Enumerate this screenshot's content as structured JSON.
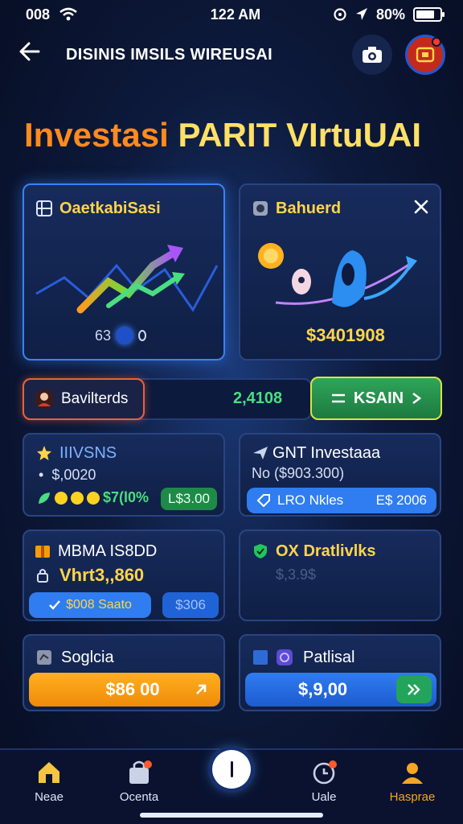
{
  "status": {
    "left": "008",
    "time": "122 AM",
    "battery": "80%",
    "battery_level": 0.8
  },
  "header": {
    "title": "DISINIS IMSILS WIREUSAI"
  },
  "hero": {
    "part1": "Investasi ",
    "part2": "PARIT VIrtuUAI"
  },
  "card_top_left": {
    "title": "OaetkabiSasi",
    "pager": "63"
  },
  "card_top_right": {
    "title": "Bahuerd",
    "amount": "$3401908"
  },
  "row_summary": {
    "label": "Bavilterds",
    "value": "2,4108",
    "action": "KSAIN"
  },
  "card_mid_left": {
    "title": "IIIVSNS",
    "sub": "$,0020",
    "rate": "$7(l0%",
    "badge": "L$3.00"
  },
  "card_mid_right": {
    "title": "GNT Investaaa",
    "sub": "No ($903.300)",
    "bar_left": "LRO Nkles",
    "bar_right": "E$ 2006"
  },
  "card_low_left": {
    "title": "MBMA IS8DD",
    "value": "Vhrt3,,860",
    "btn1": "$008 Saato",
    "btn2": "$306"
  },
  "card_low_right": {
    "title": "OX Dratlivlks",
    "sub": "$,3.9$"
  },
  "card_bot_left": {
    "title": "Soglcia",
    "btn": "$86 00"
  },
  "card_bot_right": {
    "title": "Patlisal",
    "btn": "$,9,00"
  },
  "nav": {
    "items": [
      "Neae",
      "Ocenta",
      "Uale",
      "Hasprae"
    ]
  },
  "colors": {
    "accent": "#ffd54a",
    "orange": "#ff8a1e",
    "blue": "#2f7df0",
    "green": "#22c55e"
  }
}
